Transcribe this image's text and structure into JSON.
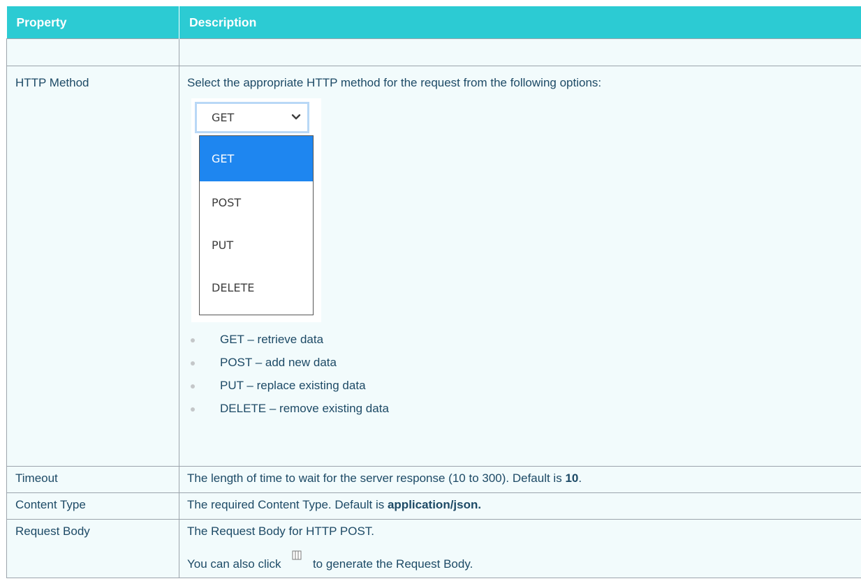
{
  "table": {
    "headers": {
      "property": "Property",
      "description": "Description"
    },
    "http_method": {
      "property": "HTTP Method",
      "lead": "Select the appropriate HTTP method for the request from the following options:",
      "dropdown": {
        "selected": "GET",
        "options": [
          "GET",
          "POST",
          "PUT",
          "DELETE"
        ],
        "chevron_icon": "chevron-down-icon"
      },
      "items": [
        "GET – retrieve data",
        "POST – add new data",
        "PUT – replace existing data",
        "DELETE – remove existing data"
      ]
    },
    "timeout": {
      "property": "Timeout",
      "description": "The length of time to wait for the server response (10 to 300). Default is ",
      "default": "10",
      "suffix": "."
    },
    "content_type": {
      "property": "Content Type",
      "description": "The required Content Type. Default is ",
      "default": "application/json."
    },
    "request_body": {
      "property": "Request Body",
      "line1": "The Request Body for HTTP POST.",
      "line2_pre": "You can also click ",
      "line2_icon": "columns-icon",
      "line2_post": " to generate the Request Body."
    }
  },
  "colors": {
    "header_bg": "#2ccbd3",
    "row_bg": "#f2fbfc",
    "text": "#1d4a66",
    "dropdown_selected": "#1e86f0"
  }
}
